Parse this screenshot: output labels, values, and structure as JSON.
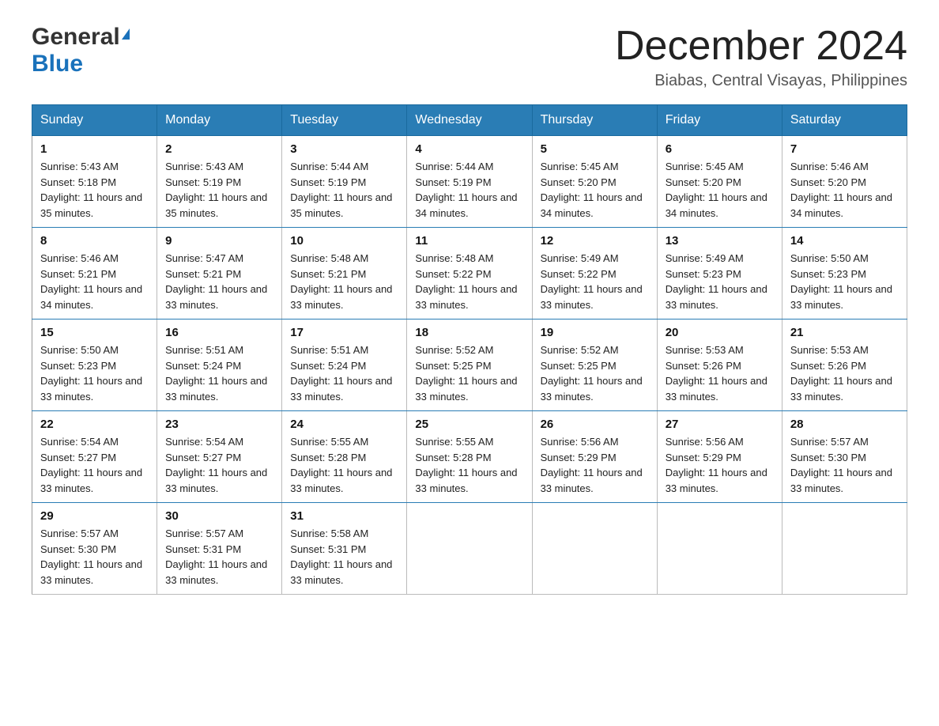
{
  "header": {
    "logo_general": "General",
    "logo_blue": "Blue",
    "month_title": "December 2024",
    "location": "Biabas, Central Visayas, Philippines"
  },
  "weekdays": [
    "Sunday",
    "Monday",
    "Tuesday",
    "Wednesday",
    "Thursday",
    "Friday",
    "Saturday"
  ],
  "weeks": [
    [
      {
        "day": "1",
        "sunrise": "5:43 AM",
        "sunset": "5:18 PM",
        "daylight": "11 hours and 35 minutes."
      },
      {
        "day": "2",
        "sunrise": "5:43 AM",
        "sunset": "5:19 PM",
        "daylight": "11 hours and 35 minutes."
      },
      {
        "day": "3",
        "sunrise": "5:44 AM",
        "sunset": "5:19 PM",
        "daylight": "11 hours and 35 minutes."
      },
      {
        "day": "4",
        "sunrise": "5:44 AM",
        "sunset": "5:19 PM",
        "daylight": "11 hours and 34 minutes."
      },
      {
        "day": "5",
        "sunrise": "5:45 AM",
        "sunset": "5:20 PM",
        "daylight": "11 hours and 34 minutes."
      },
      {
        "day": "6",
        "sunrise": "5:45 AM",
        "sunset": "5:20 PM",
        "daylight": "11 hours and 34 minutes."
      },
      {
        "day": "7",
        "sunrise": "5:46 AM",
        "sunset": "5:20 PM",
        "daylight": "11 hours and 34 minutes."
      }
    ],
    [
      {
        "day": "8",
        "sunrise": "5:46 AM",
        "sunset": "5:21 PM",
        "daylight": "11 hours and 34 minutes."
      },
      {
        "day": "9",
        "sunrise": "5:47 AM",
        "sunset": "5:21 PM",
        "daylight": "11 hours and 33 minutes."
      },
      {
        "day": "10",
        "sunrise": "5:48 AM",
        "sunset": "5:21 PM",
        "daylight": "11 hours and 33 minutes."
      },
      {
        "day": "11",
        "sunrise": "5:48 AM",
        "sunset": "5:22 PM",
        "daylight": "11 hours and 33 minutes."
      },
      {
        "day": "12",
        "sunrise": "5:49 AM",
        "sunset": "5:22 PM",
        "daylight": "11 hours and 33 minutes."
      },
      {
        "day": "13",
        "sunrise": "5:49 AM",
        "sunset": "5:23 PM",
        "daylight": "11 hours and 33 minutes."
      },
      {
        "day": "14",
        "sunrise": "5:50 AM",
        "sunset": "5:23 PM",
        "daylight": "11 hours and 33 minutes."
      }
    ],
    [
      {
        "day": "15",
        "sunrise": "5:50 AM",
        "sunset": "5:23 PM",
        "daylight": "11 hours and 33 minutes."
      },
      {
        "day": "16",
        "sunrise": "5:51 AM",
        "sunset": "5:24 PM",
        "daylight": "11 hours and 33 minutes."
      },
      {
        "day": "17",
        "sunrise": "5:51 AM",
        "sunset": "5:24 PM",
        "daylight": "11 hours and 33 minutes."
      },
      {
        "day": "18",
        "sunrise": "5:52 AM",
        "sunset": "5:25 PM",
        "daylight": "11 hours and 33 minutes."
      },
      {
        "day": "19",
        "sunrise": "5:52 AM",
        "sunset": "5:25 PM",
        "daylight": "11 hours and 33 minutes."
      },
      {
        "day": "20",
        "sunrise": "5:53 AM",
        "sunset": "5:26 PM",
        "daylight": "11 hours and 33 minutes."
      },
      {
        "day": "21",
        "sunrise": "5:53 AM",
        "sunset": "5:26 PM",
        "daylight": "11 hours and 33 minutes."
      }
    ],
    [
      {
        "day": "22",
        "sunrise": "5:54 AM",
        "sunset": "5:27 PM",
        "daylight": "11 hours and 33 minutes."
      },
      {
        "day": "23",
        "sunrise": "5:54 AM",
        "sunset": "5:27 PM",
        "daylight": "11 hours and 33 minutes."
      },
      {
        "day": "24",
        "sunrise": "5:55 AM",
        "sunset": "5:28 PM",
        "daylight": "11 hours and 33 minutes."
      },
      {
        "day": "25",
        "sunrise": "5:55 AM",
        "sunset": "5:28 PM",
        "daylight": "11 hours and 33 minutes."
      },
      {
        "day": "26",
        "sunrise": "5:56 AM",
        "sunset": "5:29 PM",
        "daylight": "11 hours and 33 minutes."
      },
      {
        "day": "27",
        "sunrise": "5:56 AM",
        "sunset": "5:29 PM",
        "daylight": "11 hours and 33 minutes."
      },
      {
        "day": "28",
        "sunrise": "5:57 AM",
        "sunset": "5:30 PM",
        "daylight": "11 hours and 33 minutes."
      }
    ],
    [
      {
        "day": "29",
        "sunrise": "5:57 AM",
        "sunset": "5:30 PM",
        "daylight": "11 hours and 33 minutes."
      },
      {
        "day": "30",
        "sunrise": "5:57 AM",
        "sunset": "5:31 PM",
        "daylight": "11 hours and 33 minutes."
      },
      {
        "day": "31",
        "sunrise": "5:58 AM",
        "sunset": "5:31 PM",
        "daylight": "11 hours and 33 minutes."
      },
      null,
      null,
      null,
      null
    ]
  ]
}
